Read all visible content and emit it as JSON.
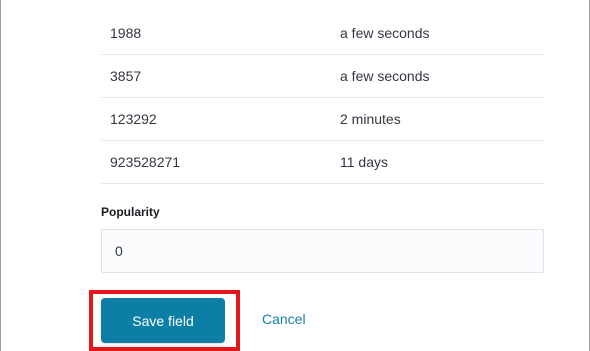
{
  "table": {
    "rows": [
      {
        "value": "1988",
        "duration": "a few seconds"
      },
      {
        "value": "3857",
        "duration": "a few seconds"
      },
      {
        "value": "123292",
        "duration": "2 minutes"
      },
      {
        "value": "923528271",
        "duration": "11 days"
      }
    ]
  },
  "popularity": {
    "label": "Popularity",
    "value": "0"
  },
  "actions": {
    "save_label": "Save field",
    "cancel_label": "Cancel"
  },
  "colors": {
    "primary": "#0d7fa6",
    "link": "#1b7fa8",
    "highlight": "#e2161b"
  }
}
